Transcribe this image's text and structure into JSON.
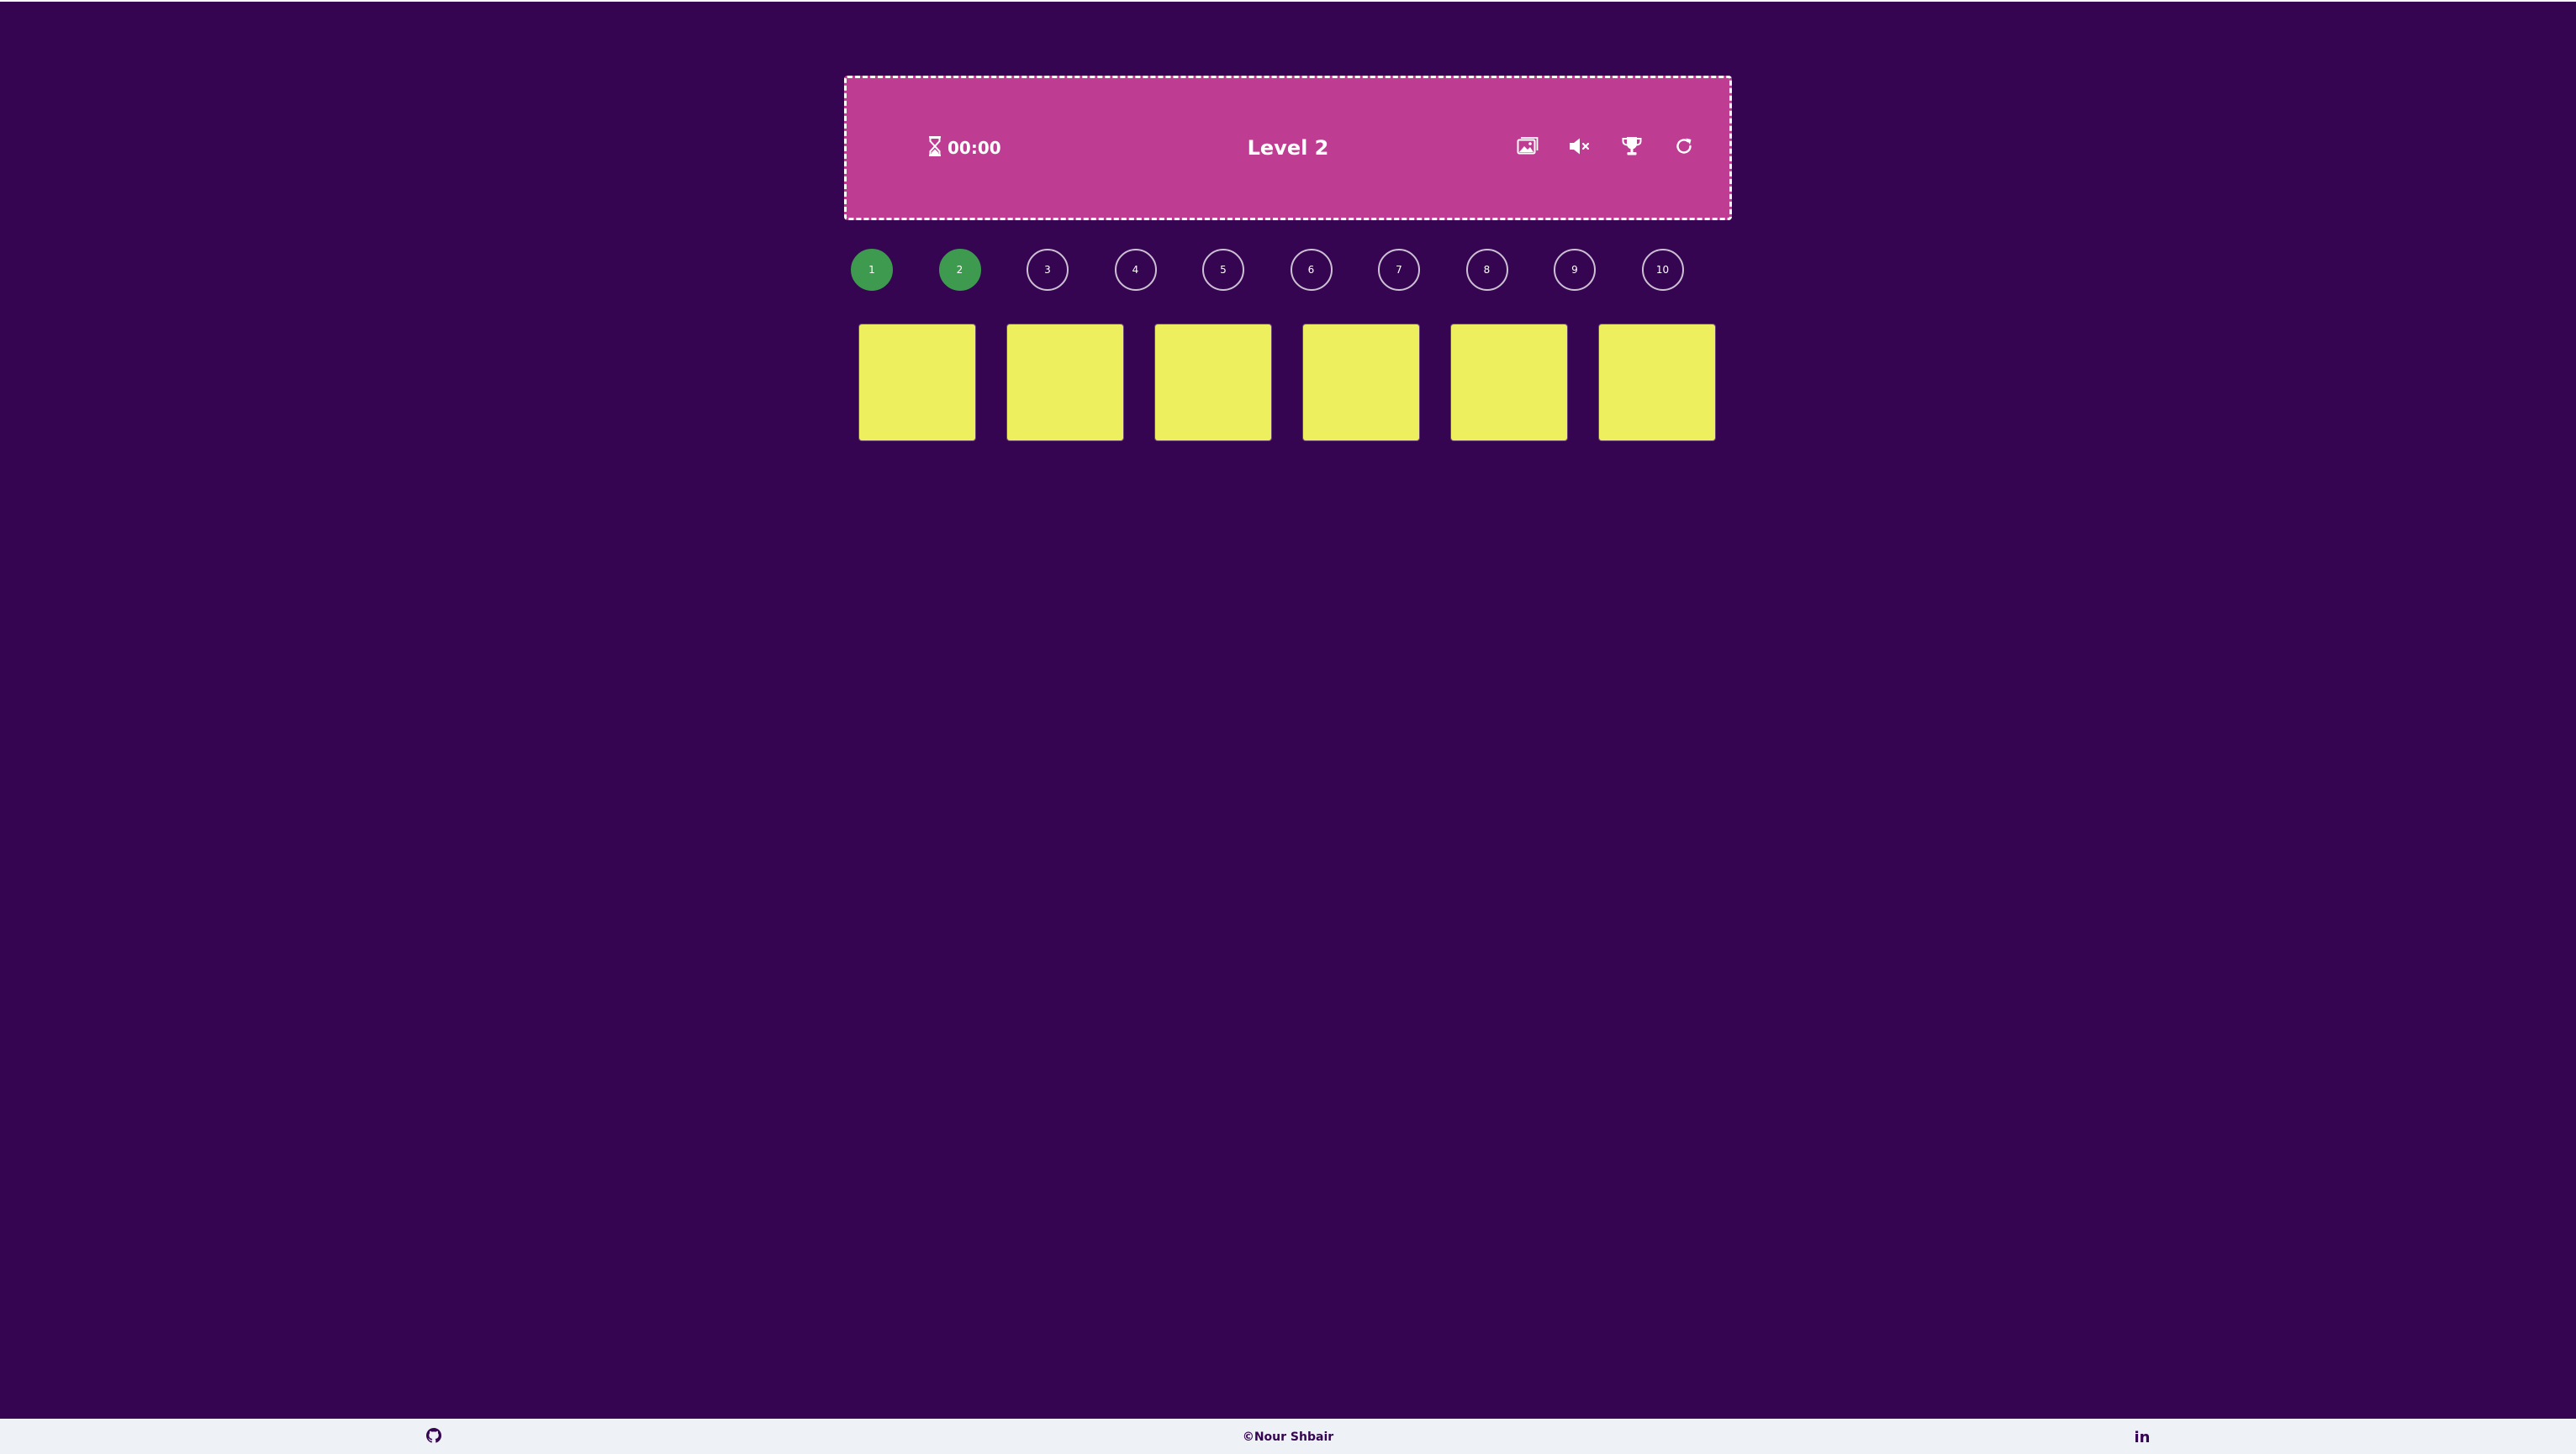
{
  "header": {
    "timer_value": "00:00",
    "level_title": "Level 2",
    "tools": [
      {
        "name": "image-icon"
      },
      {
        "name": "mute-icon"
      },
      {
        "name": "trophy-icon"
      },
      {
        "name": "restart-icon"
      }
    ]
  },
  "levels": [
    {
      "label": "1",
      "completed": true
    },
    {
      "label": "2",
      "completed": true
    },
    {
      "label": "3",
      "completed": false
    },
    {
      "label": "4",
      "completed": false
    },
    {
      "label": "5",
      "completed": false
    },
    {
      "label": "6",
      "completed": false
    },
    {
      "label": "7",
      "completed": false
    },
    {
      "label": "8",
      "completed": false
    },
    {
      "label": "9",
      "completed": false
    },
    {
      "label": "10",
      "completed": false
    }
  ],
  "cards": {
    "count_shown": 6,
    "face_down_color": "#edef5f"
  },
  "footer": {
    "copyright": "©Nour Shbair",
    "github_icon": "github-icon",
    "linkedin_icon": "linkedin-icon",
    "linkedin_text": "in"
  },
  "colors": {
    "background": "#350552",
    "header": "#be3c92",
    "level_done": "#3d9a4f",
    "footer": "#eef1f6"
  }
}
